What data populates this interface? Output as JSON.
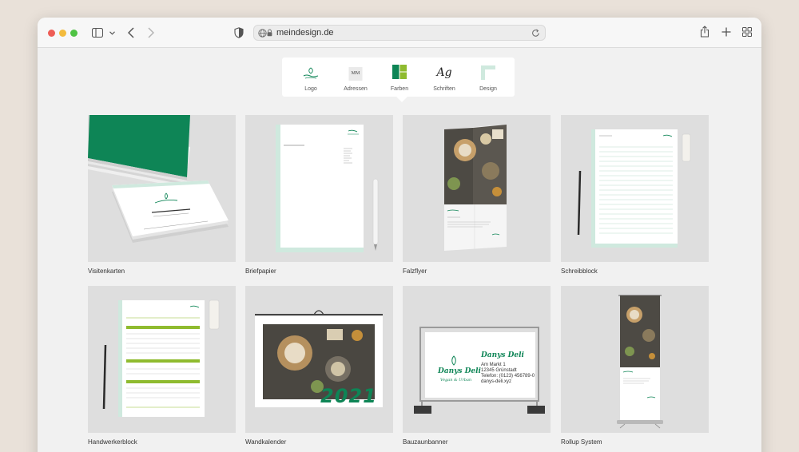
{
  "browser": {
    "url": "meindesign.de"
  },
  "tabs": [
    {
      "label": "Logo",
      "icon": "logo-mark-icon"
    },
    {
      "label": "Adressen",
      "icon": "mm-monogram-icon",
      "monogram": "MM"
    },
    {
      "label": "Farben",
      "icon": "color-swatch-icon"
    },
    {
      "label": "Schriften",
      "icon": "font-ag-icon",
      "glyph": "Ag"
    },
    {
      "label": "Design",
      "icon": "design-corner-icon"
    }
  ],
  "colors": {
    "brand_green": "#0e8556",
    "lime": "#8fbb2f",
    "mint": "#cfe9de"
  },
  "products": [
    {
      "label": "Visitenkarten"
    },
    {
      "label": "Briefpapier"
    },
    {
      "label": "Falzflyer"
    },
    {
      "label": "Schreibblock"
    },
    {
      "label": "Handwerkerblock"
    },
    {
      "label": "Wandkalender",
      "year": "2021"
    },
    {
      "label": "Bauzaunbanner",
      "brand": "Danys Deli",
      "tagline": "Vegan & Urban",
      "address": [
        "Am Markt 1",
        "12345 Grünstadt",
        "Telefon: (0123) 456789-0",
        "danys-deli.xyz"
      ]
    },
    {
      "label": "Rollup System"
    }
  ]
}
